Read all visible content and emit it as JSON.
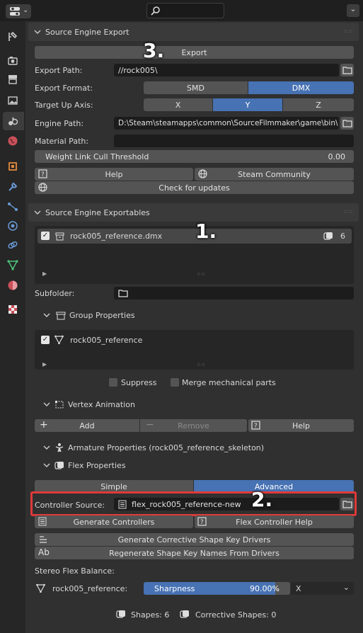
{
  "topbar": {
    "search_placeholder": ""
  },
  "export_panel": {
    "title": "Source Engine Export",
    "export_button": "Export",
    "export_path_label": "Export Path:",
    "export_path_value": "//rock005\\",
    "export_format_label": "Export Format:",
    "format_options": [
      "SMD",
      "DMX"
    ],
    "format_selected": "DMX",
    "target_up_label": "Target Up Axis:",
    "axis_options": [
      "X",
      "Y",
      "Z"
    ],
    "axis_selected": "Y",
    "engine_path_label": "Engine Path:",
    "engine_path_value": "D:\\Steam\\steamapps\\common\\SourceFilmmaker\\game\\bin\\",
    "material_path_label": "Material Path:",
    "material_path_value": "",
    "cull_label": "Weight Link Cull Threshold",
    "cull_value": "0.00",
    "help_button": "Help",
    "steam_button": "Steam Community",
    "updates_button": "Check for updates"
  },
  "exportables_panel": {
    "title": "Source Engine Exportables",
    "items": [
      {
        "name": "rock005_reference.dmx",
        "count": "6"
      }
    ],
    "subfolder_label": "Subfolder:",
    "group_properties": "Group Properties",
    "group_items": [
      {
        "name": "rock005_reference"
      }
    ],
    "suppress_label": "Suppress",
    "merge_label": "Merge mechanical parts",
    "vertex_animation": "Vertex Animation",
    "add_button": "Add",
    "remove_button": "Remove",
    "va_help_button": "Help",
    "armature_properties": "Armature Properties (rock005_reference_skeleton)",
    "flex_properties": "Flex Properties",
    "flex_modes": [
      "Simple",
      "Advanced"
    ],
    "flex_mode_selected": "Advanced",
    "controller_source_label": "Controller Source:",
    "controller_source_value": "flex_rock005_reference-new",
    "generate_controllers": "Generate Controllers",
    "flex_controller_help": "Flex Controller Help",
    "generate_corrective": "Generate Corrective Shape Key Drivers",
    "regenerate_names": "Regenerate Shape Key Names From Drivers",
    "stereo_label": "Stereo Flex Balance:",
    "stereo_object": "rock005_reference:",
    "sharpness_label": "Sharpness",
    "sharpness_value": "90.00%",
    "sharpness_fraction": 0.9,
    "stereo_axis": "X",
    "shapes_label": "Shapes: 6",
    "corrective_label": "Corrective Shapes: 0"
  },
  "annotations": {
    "one": "1.",
    "two": "2.",
    "three": "3."
  },
  "colors": {
    "accent": "#4772b3",
    "highlight_box": "#e03a3a"
  }
}
